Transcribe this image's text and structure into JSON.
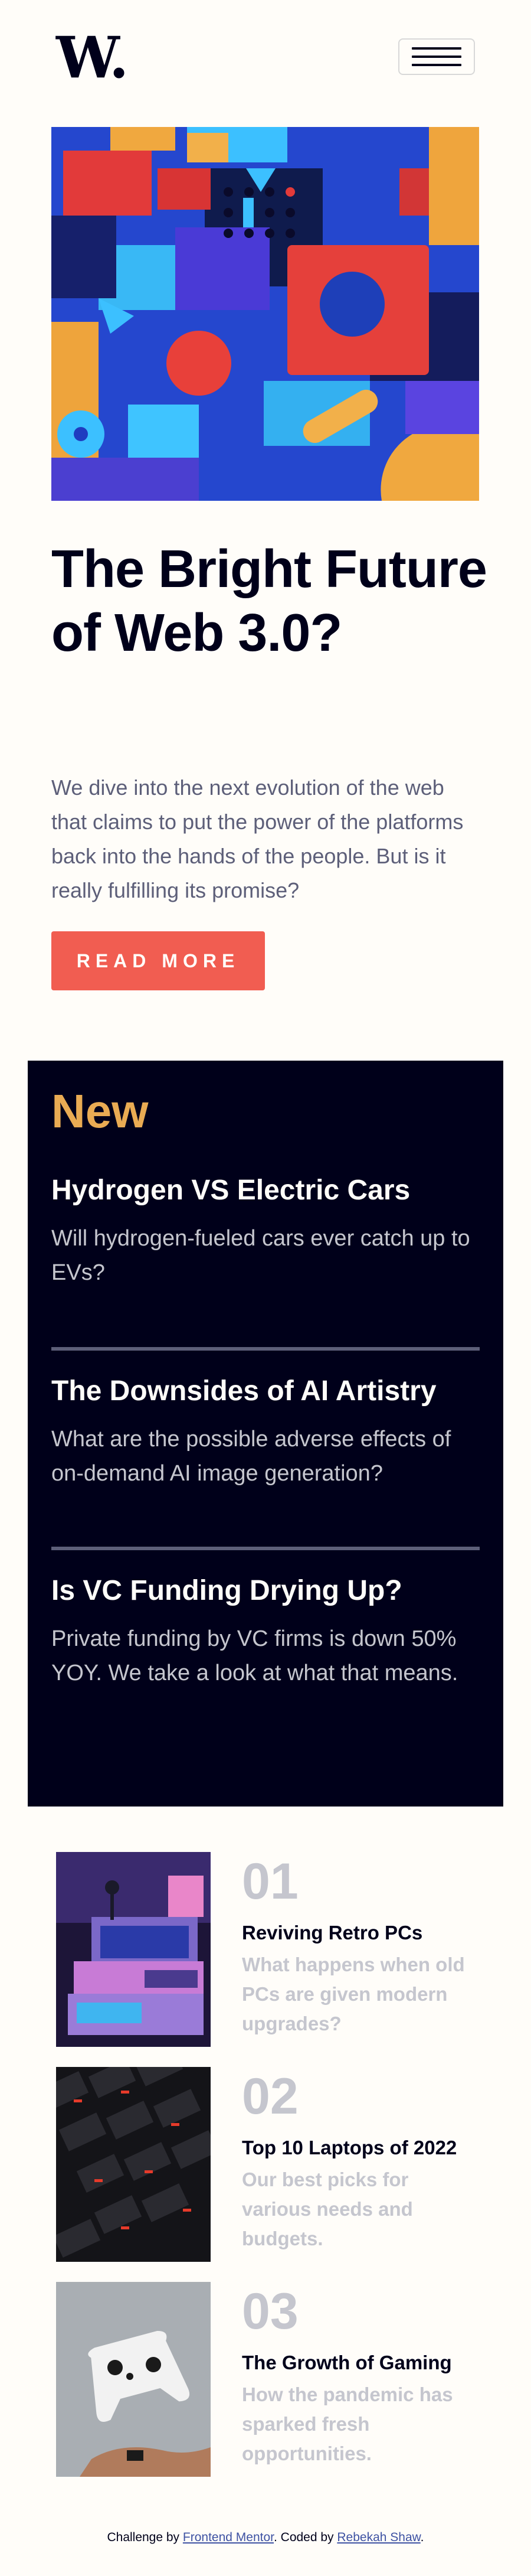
{
  "header": {
    "logo": "W.",
    "menu_icon": "hamburger-menu-icon"
  },
  "hero": {
    "image_alt": "abstract 3D geometric shapes",
    "headline": "The Bright Future of Web 3.0?",
    "intro": "We dive into the next evolution of the web that claims to put the power of the platforms back into the hands of the people. But is it really fulfilling its promise?",
    "button_label": "READ MORE"
  },
  "new_section": {
    "title": "New",
    "items": [
      {
        "title": "Hydrogen VS Electric Cars",
        "description": "Will hydrogen-fueled cars ever catch up to EVs?"
      },
      {
        "title": "The Downsides of AI Artistry",
        "description": "What are the possible adverse effects of on-demand AI image generation?"
      },
      {
        "title": "Is VC Funding Drying Up?",
        "description": "Private funding by VC firms is down 50% YOY. We take a look at what that means."
      }
    ]
  },
  "numbered_list": [
    {
      "number": "01",
      "title": "Reviving Retro PCs",
      "description": "What happens when old PCs are given modern upgrades?"
    },
    {
      "number": "02",
      "title": "Top 10 Laptops of 2022",
      "description": "Our best picks for various needs and budgets."
    },
    {
      "number": "03",
      "title": "The Growth of Gaming",
      "description": "How the pandemic has sparked fresh opportunities."
    }
  ],
  "footer": {
    "prefix": "Challenge by ",
    "link1": "Frontend Mentor",
    "middle": ". Coded by ",
    "link2": "Rebekah Shaw",
    "suffix": "."
  },
  "colors": {
    "background": "#fffdf9",
    "dark": "#00001a",
    "accent_red": "#f15d51",
    "accent_orange": "#e9ab53",
    "muted": "#5d5f79",
    "light_gray": "#c5c6ce"
  }
}
